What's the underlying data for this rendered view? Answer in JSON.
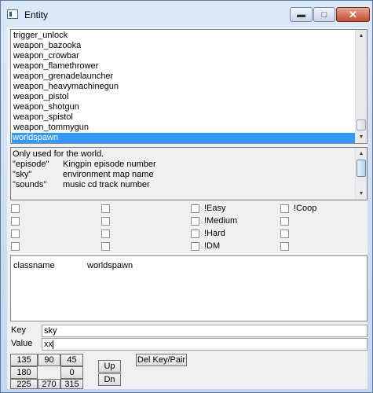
{
  "window": {
    "title": "Entity"
  },
  "class_list": {
    "items": [
      "trigger_unlock",
      "weapon_bazooka",
      "weapon_crowbar",
      "weapon_flamethrower",
      "weapon_grenadelauncher",
      "weapon_heavymachinegun",
      "weapon_pistol",
      "weapon_shotgun",
      "weapon_spistol",
      "weapon_tommygun",
      "worldspawn"
    ],
    "selected": "worldspawn"
  },
  "description": {
    "intro": "Only used for the world.",
    "rows": [
      {
        "key": "\"episode\"",
        "text": "Kingpin episode number"
      },
      {
        "key": "\"sky\"",
        "text": "environment map name"
      },
      {
        "key": "\"sounds\"",
        "text": "music cd track number"
      }
    ]
  },
  "flags": {
    "col3": [
      "!Easy",
      "!Medium",
      "!Hard",
      "!DM"
    ],
    "col4": [
      "!Coop",
      "",
      "",
      ""
    ]
  },
  "pairs": [
    {
      "key": "classname",
      "value": "worldspawn"
    }
  ],
  "fields": {
    "key_label": "Key",
    "key_value": "sky",
    "value_label": "Value",
    "value_value": "xx"
  },
  "angles": {
    "b135": "135",
    "b90": "90",
    "b45": "45",
    "b180": "180",
    "b0": "0",
    "b225": "225",
    "b270": "270",
    "b315": "315"
  },
  "buttons": {
    "up": "Up",
    "dn": "Dn",
    "del_pair": "Del Key/Pair"
  }
}
